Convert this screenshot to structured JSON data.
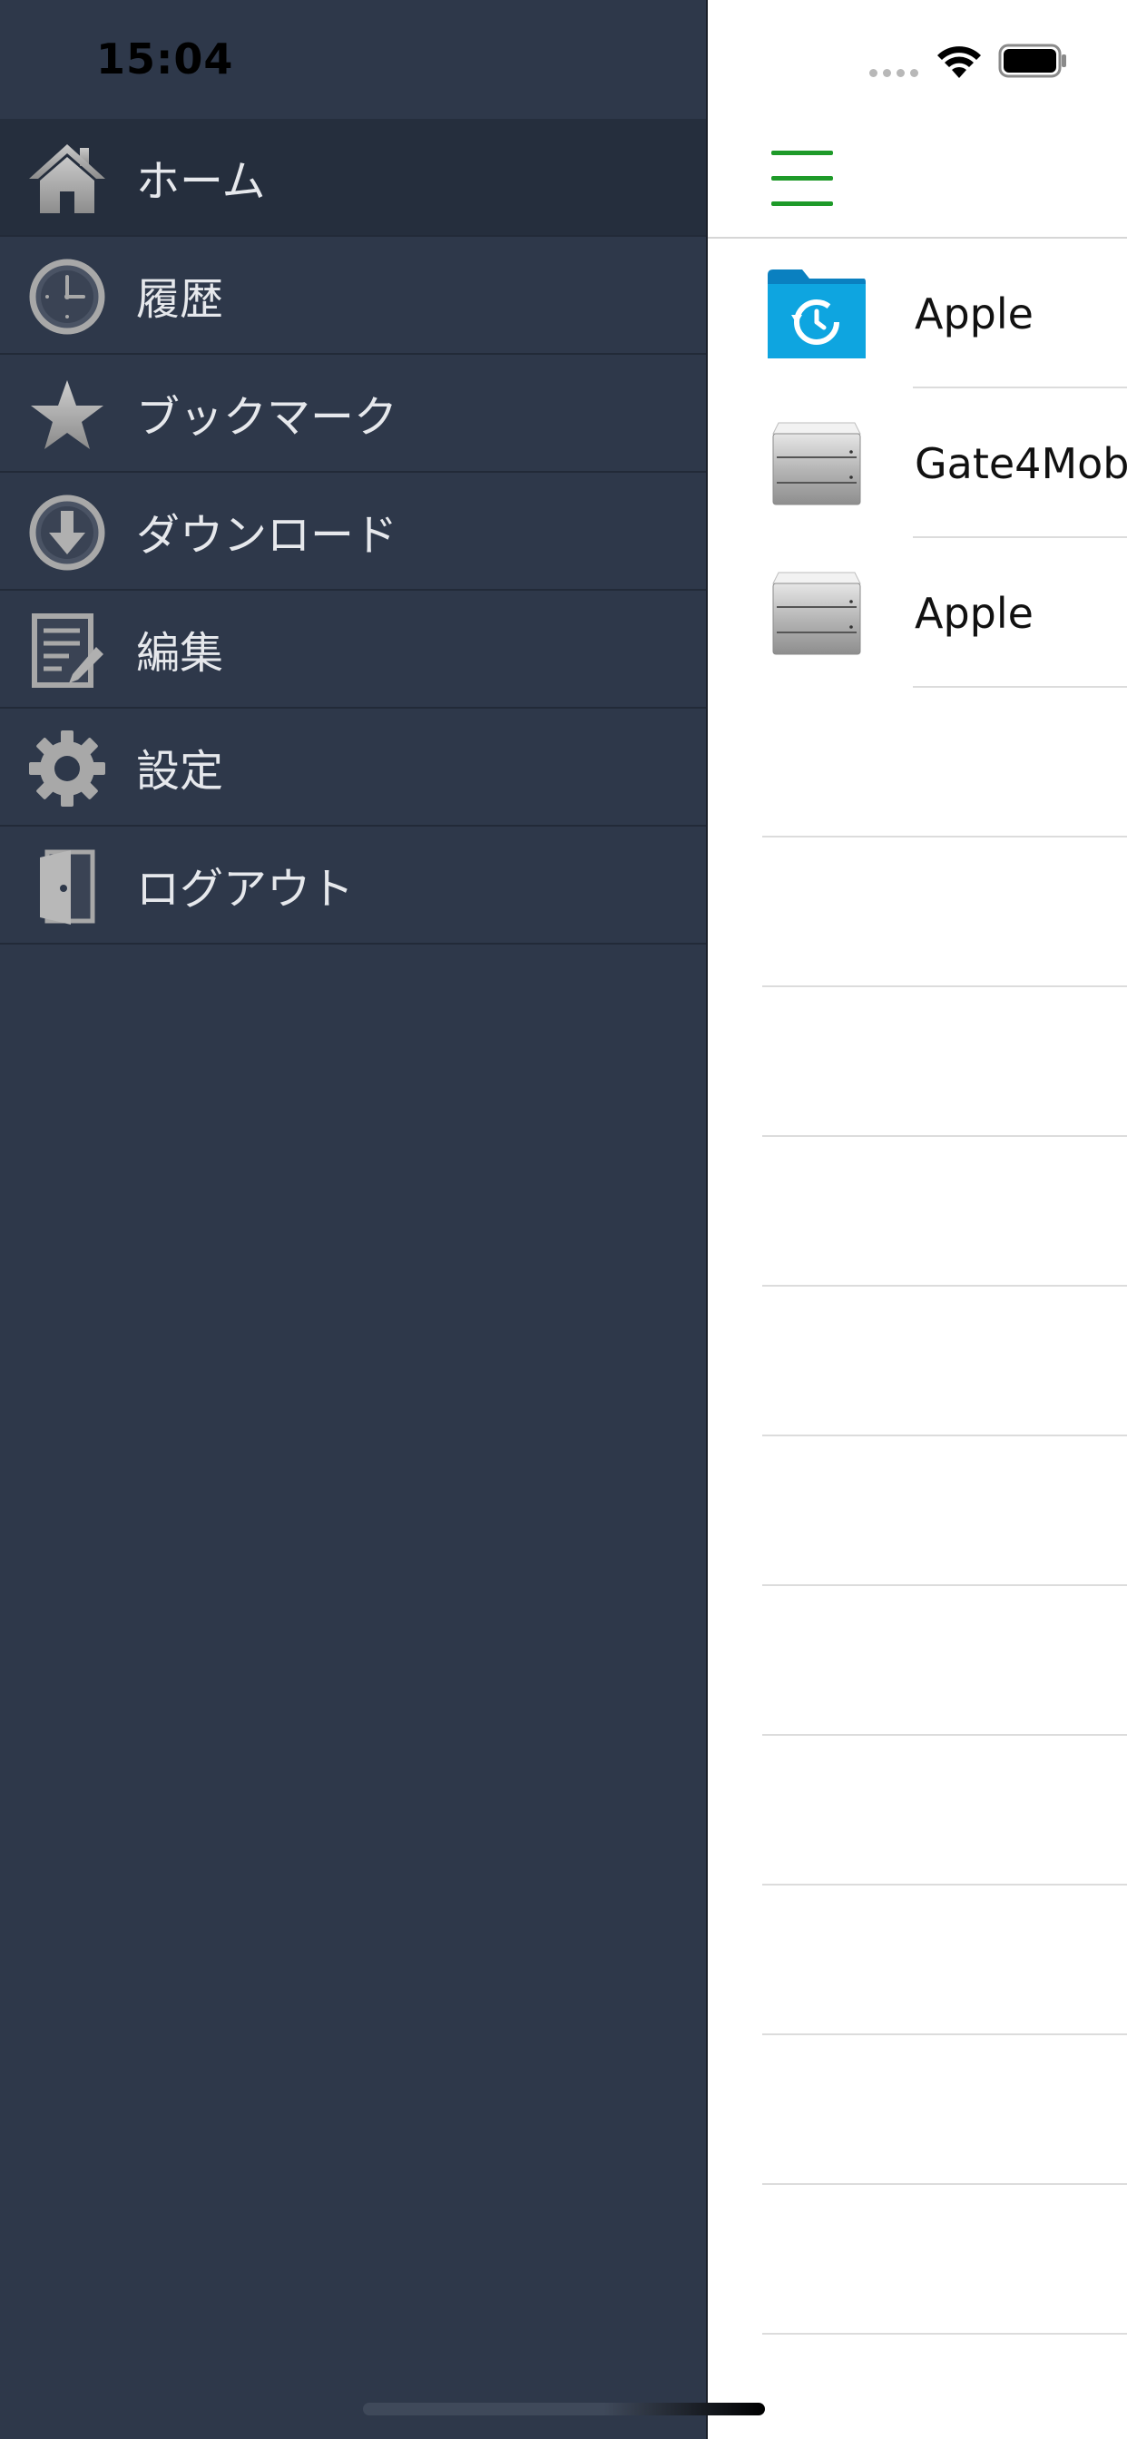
{
  "status_bar": {
    "time": "15:04"
  },
  "sidebar": {
    "items": [
      {
        "label": "ホーム",
        "icon": "home-icon",
        "active": true
      },
      {
        "label": "履歴",
        "icon": "clock-icon",
        "active": false
      },
      {
        "label": "ブックマーク",
        "icon": "star-icon",
        "active": false
      },
      {
        "label": "ダウンロード",
        "icon": "download-icon",
        "active": false
      },
      {
        "label": "編集",
        "icon": "edit-icon",
        "active": false
      },
      {
        "label": "設定",
        "icon": "gear-icon",
        "active": false
      },
      {
        "label": "ログアウト",
        "icon": "door-icon",
        "active": false
      }
    ]
  },
  "main": {
    "list": [
      {
        "label": "Apple",
        "icon": "history-folder-icon"
      },
      {
        "label": "Gate4Mob",
        "icon": "server-icon"
      },
      {
        "label": "Apple",
        "icon": "server-icon"
      }
    ]
  },
  "colors": {
    "sidebar_bg": "#2e384a",
    "sidebar_active": "#252e3d",
    "accent": "#1e9a29",
    "folder_blue": "#0ea5e0"
  }
}
